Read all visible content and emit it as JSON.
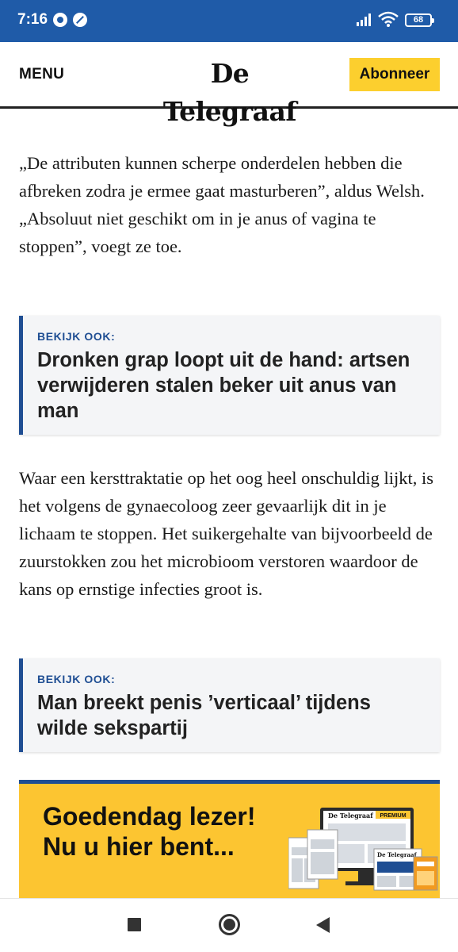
{
  "status_bar": {
    "time": "7:16",
    "battery": "68",
    "icons": [
      "chrome-icon",
      "compass-icon",
      "signal-icon",
      "wifi-icon",
      "battery-icon"
    ]
  },
  "header": {
    "menu_label": "MENU",
    "logo_text": "De Telegraaf",
    "subscribe_label": "Abonneer"
  },
  "article": {
    "paragraph_1": "„De attributen kunnen scherpe onderdelen hebben die afbreken zodra je ermee gaat masturberen”, aldus Welsh. „Absoluut niet geschikt om in je anus of vagina te stoppen”, voegt ze toe.",
    "related_1": {
      "kicker": "BEKIJK OOK:",
      "headline": "Dronken grap loopt uit de hand: artsen verwijderen stalen beker uit anus van man"
    },
    "paragraph_2": "Waar een kersttraktatie op het oog heel onschuldig lijkt, is het volgens de gynaecoloog zeer gevaarlijk dit in je lichaam te stoppen. Het suikergehalte van bijvoorbeeld de zuurstokken zou het microbioom verstoren waardoor de kans op ernstige infecties groot is.",
    "related_2": {
      "kicker": "BEKIJK OOK:",
      "headline": "Man breekt penis ’verticaal’ tijdens wilde sekspartij"
    }
  },
  "promo": {
    "line_1": "Goedendag lezer!",
    "line_2": "Nu u hier bent...",
    "badge": "PREMIUM",
    "mini_logo": "De Telegraaf"
  },
  "navigation_bar": {
    "icons": [
      "recents-square-icon",
      "home-circle-icon",
      "back-triangle-icon"
    ]
  },
  "colors": {
    "status_bar": "#1f5ba8",
    "accent_blue": "#1f4e93",
    "subscribe_yellow": "#fccf2e",
    "promo_yellow": "#fcc531"
  }
}
